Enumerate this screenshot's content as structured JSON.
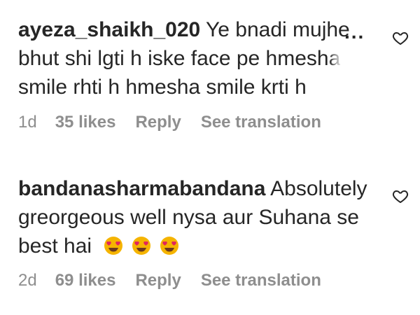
{
  "comments": [
    {
      "username": "ayeza_shaikh_020",
      "text_part1": "Ye bnadi mujhe",
      "text_line2": "bhut shi lgti h iske face pe hmesh",
      "text_line2_fade": "a",
      "text_line3": "smile rhti h hmesha smile krti h",
      "more_label": "...",
      "time": "1d",
      "likes": "35 likes",
      "reply_label": "Reply",
      "translate_label": "See translation"
    },
    {
      "username": "bandanasharmabandana",
      "text_part1": "Absolutely",
      "text_line2": "greorgeous well nysa aur Suhana se",
      "text_line3": "best hai",
      "emojis": [
        "heart-eyes-emoji",
        "heart-eyes-emoji",
        "heart-eyes-emoji"
      ],
      "time": "2d",
      "likes": "69 likes",
      "reply_label": "Reply",
      "translate_label": "See translation"
    }
  ],
  "icons": {
    "like": "heart-outline-icon",
    "more": "more-options-icon",
    "emoji": "heart-eyes-emoji"
  },
  "colors": {
    "text": "#262626",
    "meta": "#8e8e8e",
    "emoji_face": "#f5b400",
    "emoji_heart": "#e0245e"
  }
}
